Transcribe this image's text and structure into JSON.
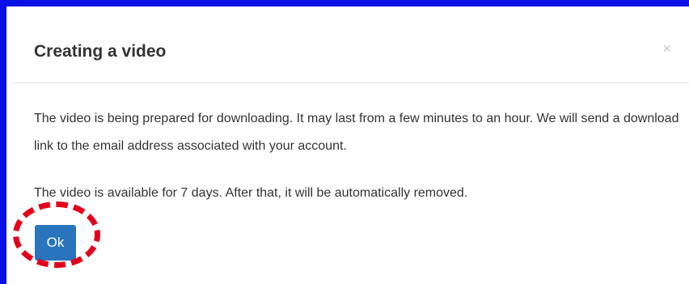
{
  "dialog": {
    "title": "Creating a video",
    "close_glyph": "×",
    "paragraphs": [
      "The video is being prepared for downloading. It may last from a few minutes to an hour. We will send a download link to the email address associated with your account.",
      "The video is available for 7 days. After that, it will be automatically removed."
    ],
    "ok_label": "Ok"
  },
  "colors": {
    "frame_border": "#0a10e6",
    "button_bg": "#2a74bd",
    "annotation": "#e3001b"
  }
}
